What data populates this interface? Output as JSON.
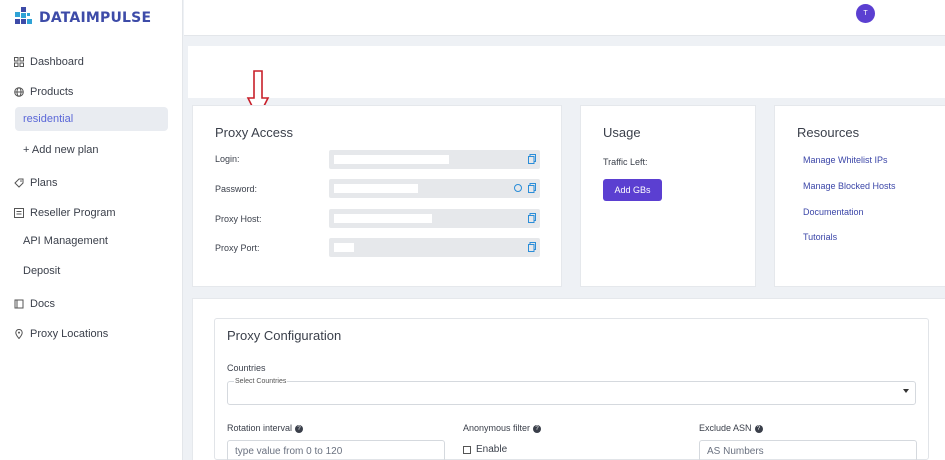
{
  "brand": {
    "name": "DATAIMPULSE"
  },
  "sidebar": {
    "items": [
      {
        "label": "Dashboard",
        "icon": "grid-icon"
      },
      {
        "label": "Products",
        "icon": "globe-icon"
      },
      {
        "label": "residential",
        "active": true
      },
      {
        "label": "+ Add new plan"
      },
      {
        "label": "Plans",
        "icon": "tag-icon"
      },
      {
        "label": "Reseller Program",
        "icon": "reseller-icon"
      },
      {
        "label": "API Management"
      },
      {
        "label": "Deposit"
      },
      {
        "label": "Docs",
        "icon": "docs-icon"
      },
      {
        "label": "Proxy Locations",
        "icon": "pin-icon"
      }
    ]
  },
  "user": {
    "avatar_initial": "T"
  },
  "proxy_access": {
    "title": "Proxy Access",
    "fields": [
      {
        "label": "Login:"
      },
      {
        "label": "Password:"
      },
      {
        "label": "Proxy Host:"
      },
      {
        "label": "Proxy Port:"
      }
    ]
  },
  "usage": {
    "title": "Usage",
    "traffic_label": "Traffic Left:",
    "add_button": "Add GBs"
  },
  "resources": {
    "title": "Resources",
    "links": [
      "Manage Whitelist IPs",
      "Manage Blocked Hosts",
      "Documentation",
      "Tutorials"
    ]
  },
  "config": {
    "title": "Proxy Configuration",
    "countries_label": "Countries",
    "countries_select_label": "Select Countries",
    "rotation_label": "Rotation interval",
    "rotation_placeholder": "type value from 0 to 120",
    "anon_label": "Anonymous filter",
    "anon_checkbox": "Enable",
    "asn_label": "Exclude ASN",
    "asn_placeholder": "AS Numbers"
  },
  "colors": {
    "accent": "#5b3fd1",
    "brand": "#3d4ba8",
    "link": "#3b46a8",
    "annotation_arrow": "#c8202a"
  }
}
